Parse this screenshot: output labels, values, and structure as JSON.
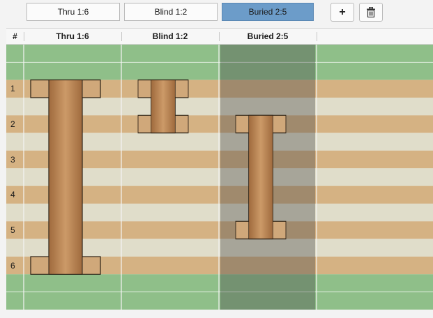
{
  "toolbar": {
    "tabs": [
      {
        "label": "Thru 1:6",
        "active": false
      },
      {
        "label": "Blind 1:2",
        "active": false
      },
      {
        "label": "Buried 2:5",
        "active": true
      }
    ],
    "add_icon": "plus-icon",
    "delete_icon": "trash-icon",
    "add_label": "+"
  },
  "grid": {
    "headers": {
      "number": "#",
      "columns": [
        "Thru 1:6",
        "Blind 1:2",
        "Buried 2:5"
      ]
    },
    "layers": [
      {
        "type": "dielectric",
        "label": ""
      },
      {
        "type": "dielectric",
        "label": ""
      },
      {
        "type": "copper",
        "label": "1"
      },
      {
        "type": "core",
        "label": ""
      },
      {
        "type": "copper",
        "label": "2"
      },
      {
        "type": "core",
        "label": ""
      },
      {
        "type": "copper",
        "label": "3"
      },
      {
        "type": "core",
        "label": ""
      },
      {
        "type": "copper",
        "label": "4"
      },
      {
        "type": "core",
        "label": ""
      },
      {
        "type": "copper",
        "label": "5"
      },
      {
        "type": "core",
        "label": ""
      },
      {
        "type": "copper",
        "label": "6"
      },
      {
        "type": "dielectric",
        "label": ""
      },
      {
        "type": "dielectric",
        "label": ""
      }
    ],
    "vias": [
      {
        "name": "Thru 1:6",
        "column": 0,
        "from": 1,
        "to": 6
      },
      {
        "name": "Blind 1:2",
        "column": 1,
        "from": 1,
        "to": 2
      },
      {
        "name": "Buried 2:5",
        "column": 2,
        "from": 2,
        "to": 5
      }
    ],
    "selected_column": 2
  },
  "colors": {
    "dielectric": "#8fbf89",
    "copper": "#d5b283",
    "core": "#e0ddca",
    "selected_overlay": "#4a4a4a",
    "active_tab": "#6c9cc9",
    "barrel": "#b98556",
    "pad": "#d0a87a"
  }
}
